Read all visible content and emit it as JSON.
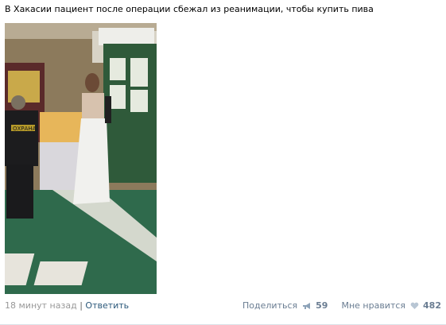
{
  "post": {
    "text": "В Хакасии пациент после операции сбежал из реанимации, чтобы купить пива",
    "photo_labels": {
      "guard_patch": "ОХРАНА"
    }
  },
  "footer": {
    "time": "18 минут назад",
    "separator": "|",
    "reply": "Ответить",
    "share_label": "Поделиться",
    "share_count": "59",
    "like_label": "Мне нравится",
    "like_count": "482"
  },
  "colors": {
    "link": "#2b587a",
    "muted": "#999999",
    "stat": "#6a7d92"
  },
  "icons": {
    "share": "megaphone-icon",
    "like": "heart-icon"
  }
}
